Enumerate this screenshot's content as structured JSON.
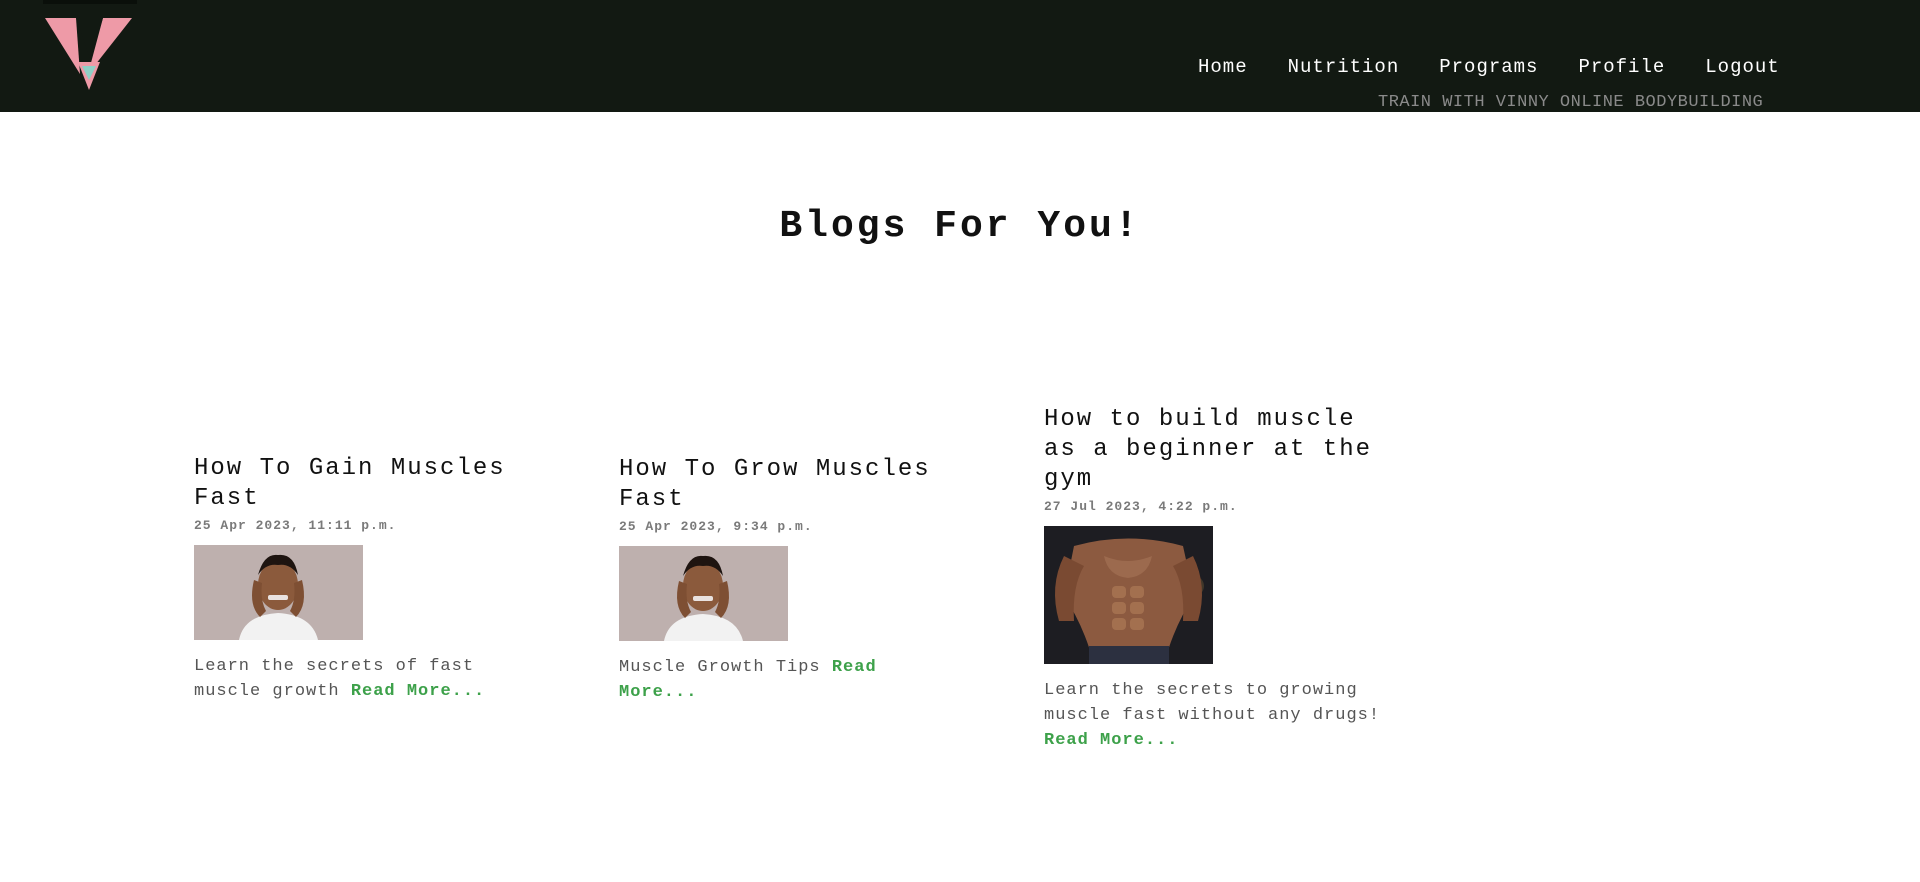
{
  "nav": {
    "links": [
      "Home",
      "Nutrition",
      "Programs",
      "Profile",
      "Logout"
    ],
    "tagline": "TRAIN WITH VINNY ONLINE BODYBUILDING",
    "logo_icon": "logo-triangle-icon",
    "background": "#121912",
    "logo_color": "#ee9aa7"
  },
  "main": {
    "title": "Blogs For You!"
  },
  "blogs": [
    {
      "title": "How To Gain Muscles Fast",
      "date": "25 Apr 2023, 11:11 p.m.",
      "description": "Learn the secrets of fast muscle growth",
      "read_more": "Read More...",
      "image_icon": "stressed-man-photo"
    },
    {
      "title": "How To Grow Muscles Fast",
      "date": "25 Apr 2023, 9:34 p.m.",
      "description": "Muscle Growth Tips",
      "read_more": "Read More...",
      "image_icon": "stressed-man-photo"
    },
    {
      "title": "How to build muscle as a beginner at the gym",
      "date": "27 Jul 2023, 4:22 p.m.",
      "description": "Learn the secrets to growing muscle fast without any drugs!",
      "read_more": "Read More...",
      "image_icon": "bodybuilder-photo"
    }
  ],
  "colors": {
    "link_green": "#3da14a"
  }
}
